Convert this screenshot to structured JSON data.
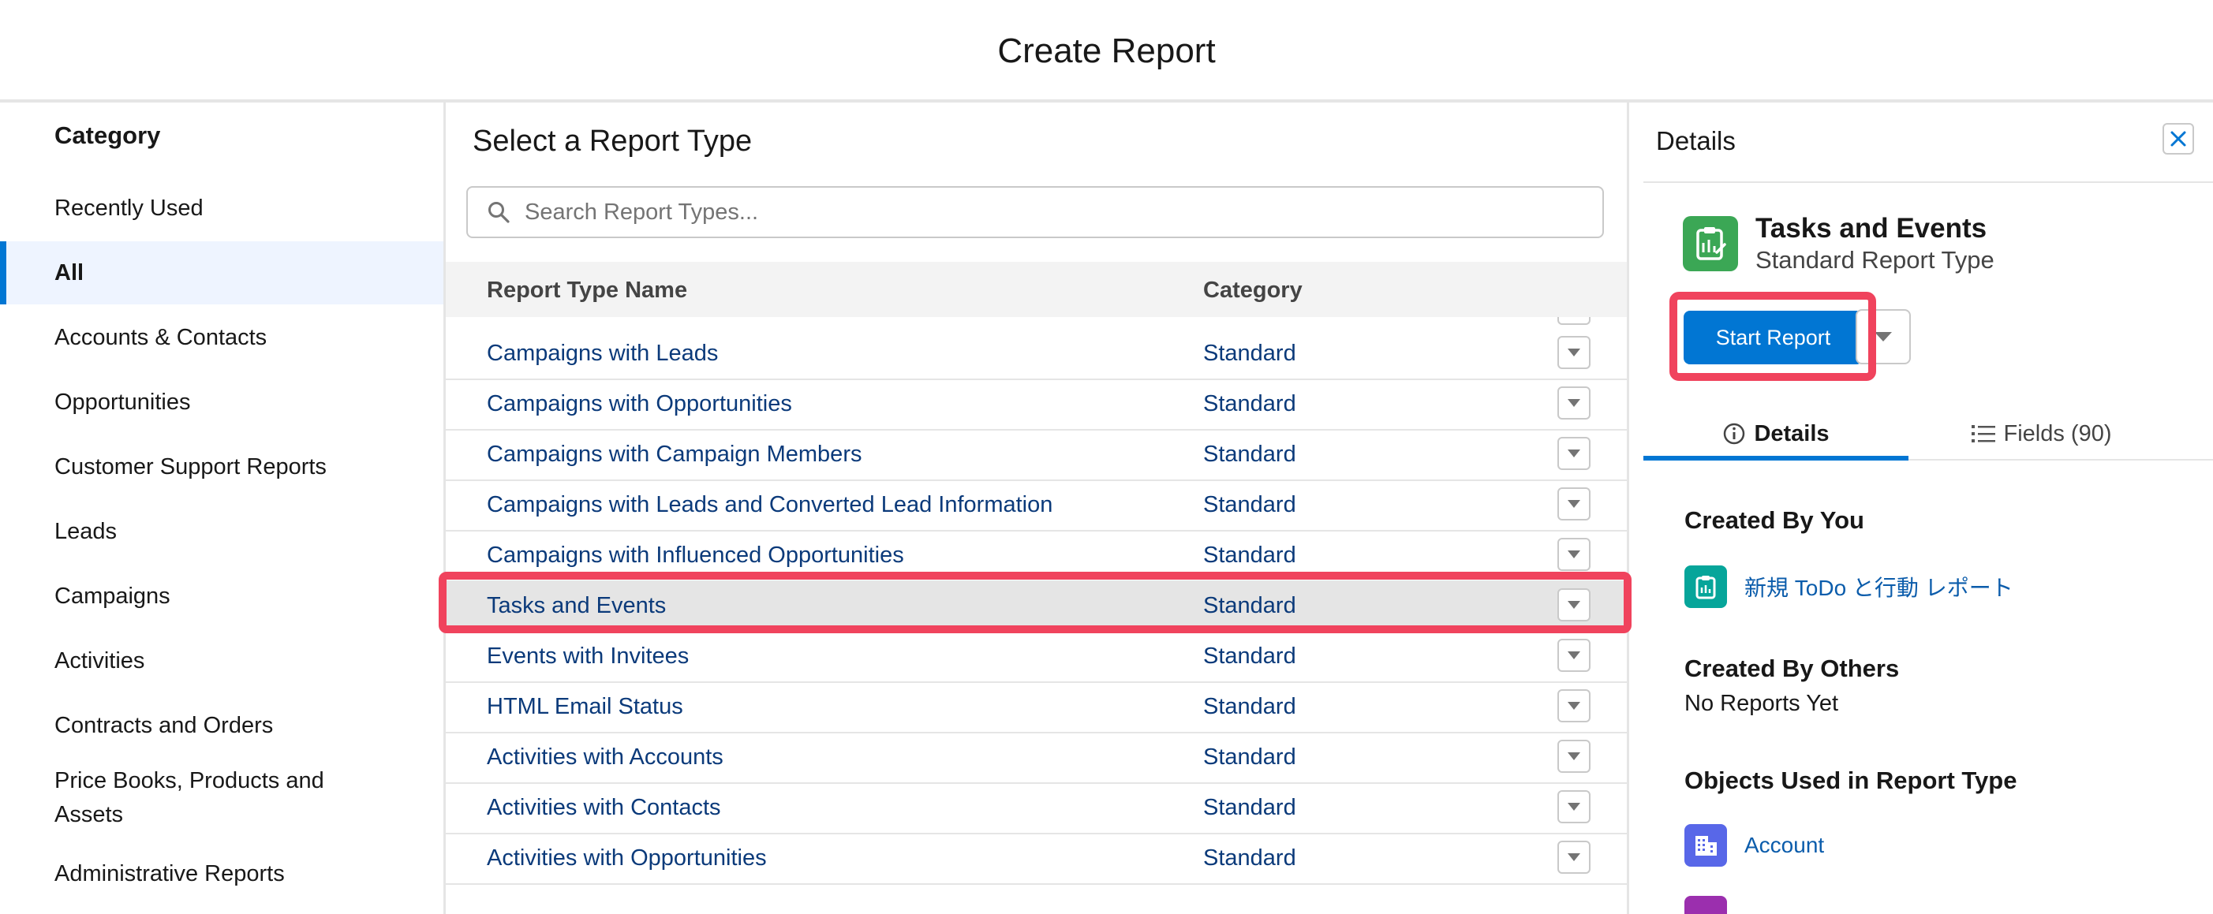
{
  "header": {
    "title": "Create Report"
  },
  "categories": {
    "heading": "Category",
    "items": [
      {
        "label": "Recently Used"
      },
      {
        "label": "All",
        "active": true
      },
      {
        "label": "Accounts & Contacts"
      },
      {
        "label": "Opportunities"
      },
      {
        "label": "Customer Support Reports"
      },
      {
        "label": "Leads"
      },
      {
        "label": "Campaigns"
      },
      {
        "label": "Activities"
      },
      {
        "label": "Contracts and Orders"
      },
      {
        "label": "Price Books, Products and Assets"
      },
      {
        "label": "Administrative Reports"
      }
    ]
  },
  "report_types": {
    "title": "Select a Report Type",
    "search_placeholder": "Search Report Types...",
    "columns": {
      "name": "Report Type Name",
      "category": "Category"
    },
    "rows": [
      {
        "name": "Campaigns with Leads",
        "category": "Standard"
      },
      {
        "name": "Campaigns with Opportunities",
        "category": "Standard"
      },
      {
        "name": "Campaigns with Campaign Members",
        "category": "Standard"
      },
      {
        "name": "Campaigns with Leads and Converted Lead Information",
        "category": "Standard"
      },
      {
        "name": "Campaigns with Influenced Opportunities",
        "category": "Standard"
      },
      {
        "name": "Tasks and Events",
        "category": "Standard",
        "selected": true
      },
      {
        "name": "Events with Invitees",
        "category": "Standard"
      },
      {
        "name": "HTML Email Status",
        "category": "Standard"
      },
      {
        "name": "Activities with Accounts",
        "category": "Standard"
      },
      {
        "name": "Activities with Contacts",
        "category": "Standard"
      },
      {
        "name": "Activities with Opportunities",
        "category": "Standard"
      }
    ]
  },
  "details": {
    "title": "Details",
    "report_type_name": "Tasks and Events",
    "report_type_kind": "Standard Report Type",
    "start_button": "Start Report",
    "tabs": [
      {
        "label": "Details",
        "icon": "info-icon",
        "active": true
      },
      {
        "label": "Fields (90)",
        "icon": "list-icon"
      }
    ],
    "created_by_you": {
      "heading": "Created By You",
      "items": [
        {
          "label": "新規 ToDo と行動 レポート",
          "icon": "report-icon"
        }
      ]
    },
    "created_by_others": {
      "heading": "Created By Others",
      "empty_text": "No Reports Yet"
    },
    "objects_used": {
      "heading": "Objects Used in Report Type",
      "items": [
        {
          "label": "Account",
          "icon": "building-icon"
        }
      ]
    }
  },
  "colors": {
    "brand_blue": "#0176d3",
    "highlight_red": "#f0435d",
    "report_icon_green": "#3ba755",
    "report_icon_teal": "#06a59a",
    "account_icon_purple": "#5867e8",
    "link_blue": "#0b5cab",
    "row_text_navy": "#0b3a7a"
  }
}
